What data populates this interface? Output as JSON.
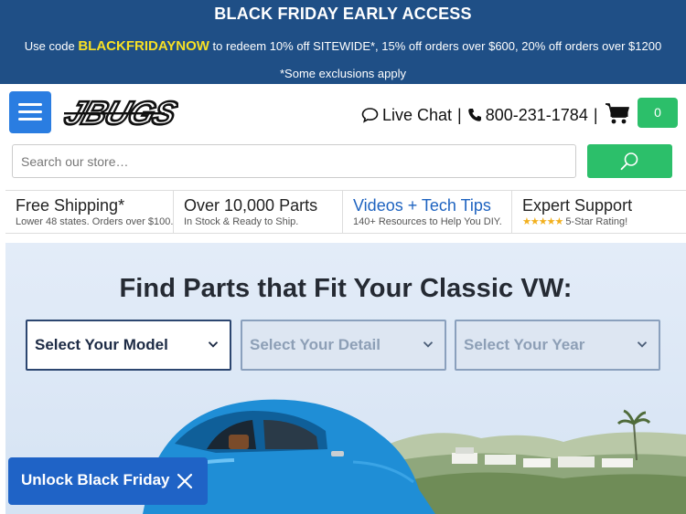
{
  "promo": {
    "title": "BLACK FRIDAY EARLY ACCESS",
    "prefix": "Use code ",
    "code": "BLACKFRIDAYNOW",
    "suffix": " to redeem 10% off SITEWIDE*, 15% off orders over $600, 20% off orders over $1200 *Some exclusions apply"
  },
  "header": {
    "logo_text": "JBUGS",
    "live_chat": "Live Chat",
    "separator": "|",
    "phone": "800-231-1784",
    "cart_count": "0"
  },
  "search": {
    "placeholder": "Search our store…"
  },
  "features": [
    {
      "title": "Free Shipping*",
      "subtitle": "Lower 48 states. Orders over $100."
    },
    {
      "title": "Over 10,000 Parts",
      "subtitle": "In Stock & Ready to Ship."
    },
    {
      "title": "Videos + Tech Tips",
      "subtitle": "140+ Resources to Help You DIY."
    },
    {
      "title": "Expert Support",
      "stars": "★★★★★",
      "subtitle": "5-Star Rating!"
    }
  ],
  "hero": {
    "heading": "Find Parts that Fit Your Classic VW:",
    "selects": [
      "Select Your Model",
      "Select Your Detail",
      "Select Your Year"
    ]
  },
  "unlock": {
    "label": "Unlock Black Friday"
  },
  "colors": {
    "banner": "#1f4f86",
    "code": "#f7e024",
    "accent_blue": "#2a7de1",
    "accent_green": "#2cbf6a"
  },
  "icons": [
    "menu-icon",
    "chat-icon",
    "phone-icon",
    "cart-icon",
    "search-icon",
    "chevron-down-icon",
    "close-icon"
  ]
}
